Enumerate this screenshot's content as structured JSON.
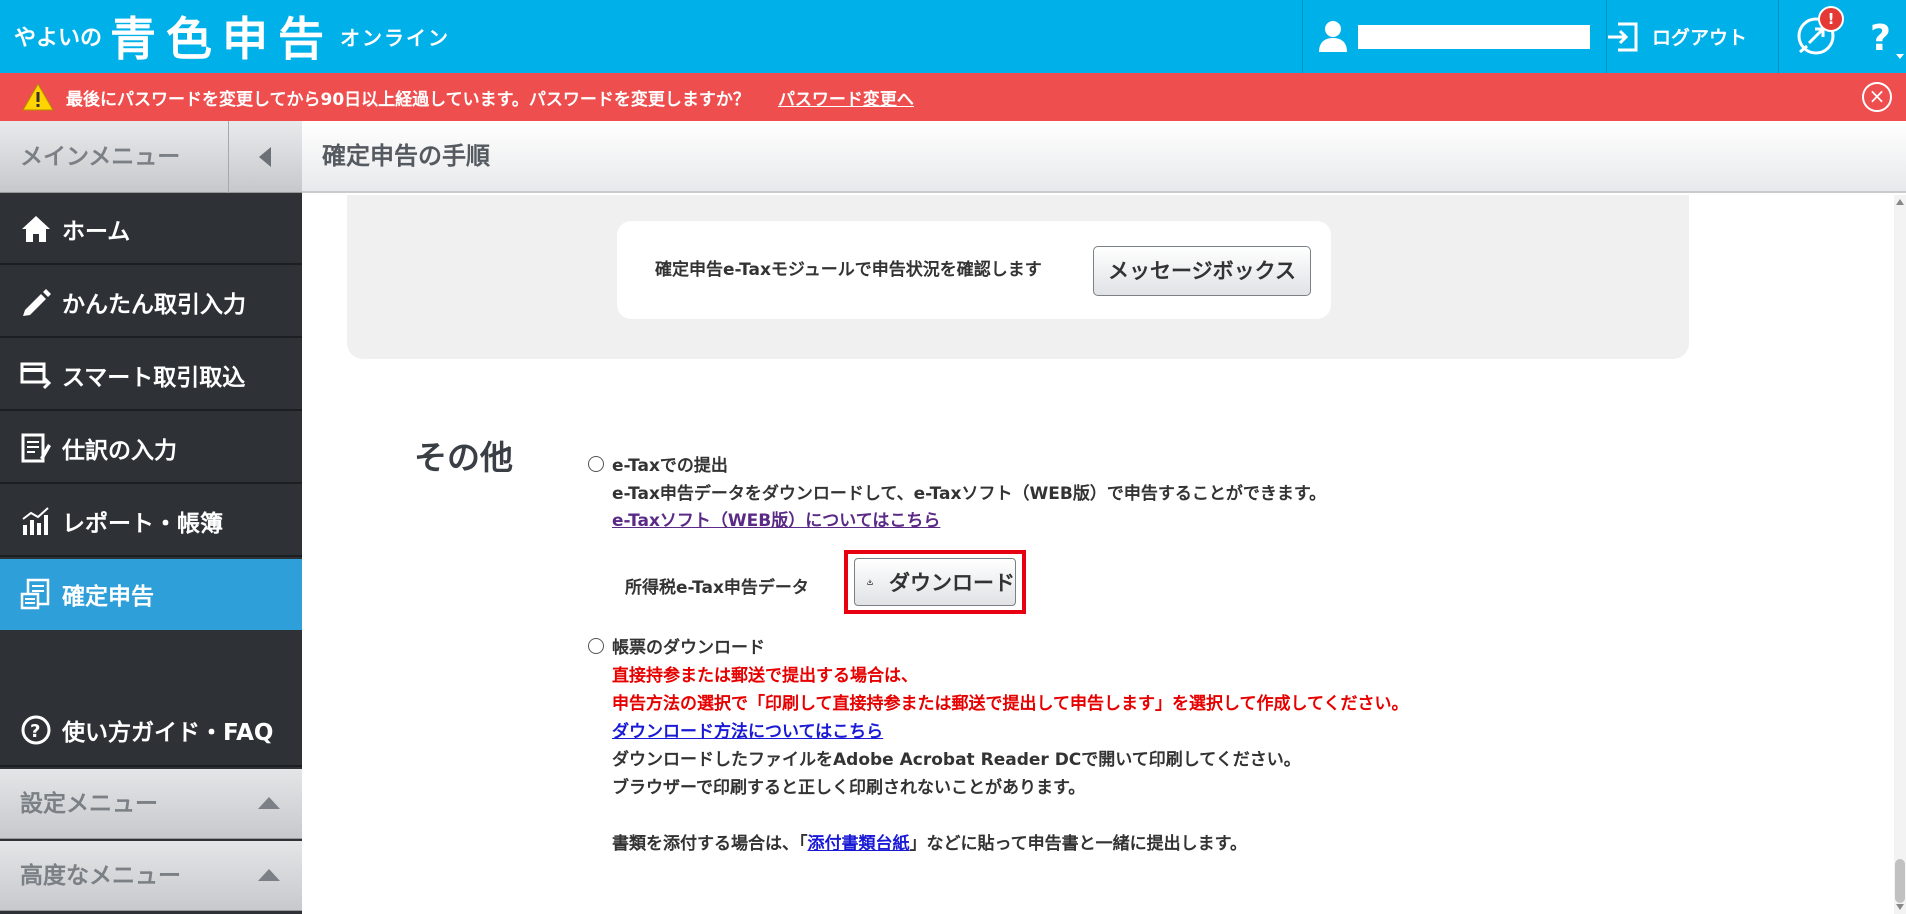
{
  "header": {
    "brand_small": "やよいの",
    "brand_big": "青色申告",
    "brand_online": "オンライン",
    "logout_label": "ログアウト",
    "notify_badge": "!",
    "help_glyph": "?"
  },
  "alert": {
    "message": "最後にパスワードを変更してから90日以上経過しています。パスワードを変更しますか？",
    "link": "パスワード変更へ",
    "close_glyph": "×"
  },
  "sidebar": {
    "title": "メインメニュー",
    "items": [
      {
        "label": "ホーム",
        "icon": "home-icon"
      },
      {
        "label": "かんたん取引入力",
        "icon": "pencil-icon"
      },
      {
        "label": "スマート取引取込",
        "icon": "import-icon"
      },
      {
        "label": "仕訳の入力",
        "icon": "journal-icon"
      },
      {
        "label": "レポート・帳簿",
        "icon": "report-icon"
      },
      {
        "label": "確定申告",
        "icon": "tax-return-icon",
        "active": true
      }
    ],
    "guide": {
      "label": "使い方ガイド・FAQ",
      "icon": "help-circle-icon"
    },
    "settings_menu": "設定メニュー",
    "advanced_menu": "高度なメニュー"
  },
  "main": {
    "page_title": "確定申告の手順",
    "message_box": {
      "text": "確定申告e-Taxモジュールで申告状況を確認します",
      "button": "メッセージボックス"
    },
    "section_title": "その他",
    "etax": {
      "radio_label": "e-Taxでの提出",
      "description": "e-Tax申告データをダウンロードして、e-Taxソフト（WEB版）で申告することができます。",
      "link": "e-Taxソフト（WEB版）についてはこちら",
      "download_label": "所得税e-Tax申告データ",
      "download_button": "ダウンロード"
    },
    "forms": {
      "radio_label": "帳票のダウンロード",
      "red_line1": "直接持参または郵送で提出する場合は、",
      "red_line2": "申告方法の選択で「印刷して直接持参または郵送で提出して申告します」を選択して作成してください。",
      "link": "ダウンロード方法についてはこちら",
      "line3": "ダウンロードしたファイルをAdobe Acrobat Reader DCで開いて印刷してください。",
      "line4": "ブラウザーで印刷すると正しく印刷されないことがあります。",
      "attach_prefix": "書類を添付する場合は、「",
      "attach_link": "添付書類台紙",
      "attach_suffix": "」などに貼って申告書と一緒に提出します。"
    }
  },
  "colors": {
    "header": "#00b0e8",
    "alert": "#ef4e4e",
    "sidebar": "#2e3236",
    "active": "#2f9fd9",
    "highlight": "#e60012"
  }
}
